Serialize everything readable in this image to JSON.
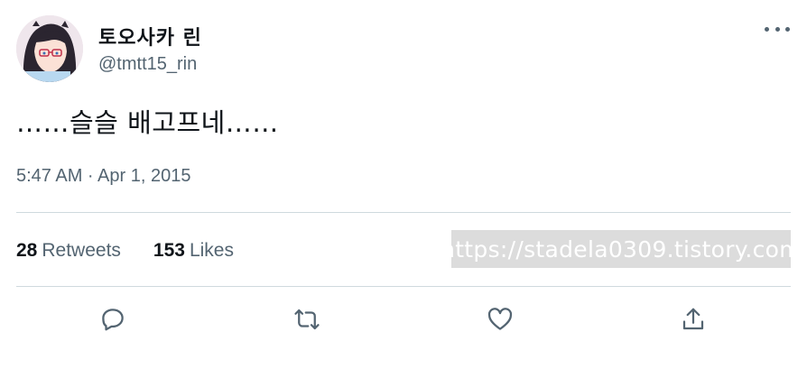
{
  "tweet": {
    "author_name": "토오사카 린",
    "author_handle": "@tmtt15_rin",
    "text": "……슬슬 배고프네……",
    "timestamp": "5:47 AM · Apr 1, 2015"
  },
  "stats": {
    "retweets_count": "28",
    "retweets_label": "Retweets",
    "likes_count": "153",
    "likes_label": "Likes"
  },
  "watermark": "https://stadela0309.tistory.com",
  "icons": {
    "more": "more-icon",
    "reply": "reply-icon",
    "retweet": "retweet-icon",
    "like": "heart-icon",
    "share": "share-icon"
  },
  "colors": {
    "text": "#0f1419",
    "secondary": "#536471",
    "divider": "#cfd9de"
  }
}
